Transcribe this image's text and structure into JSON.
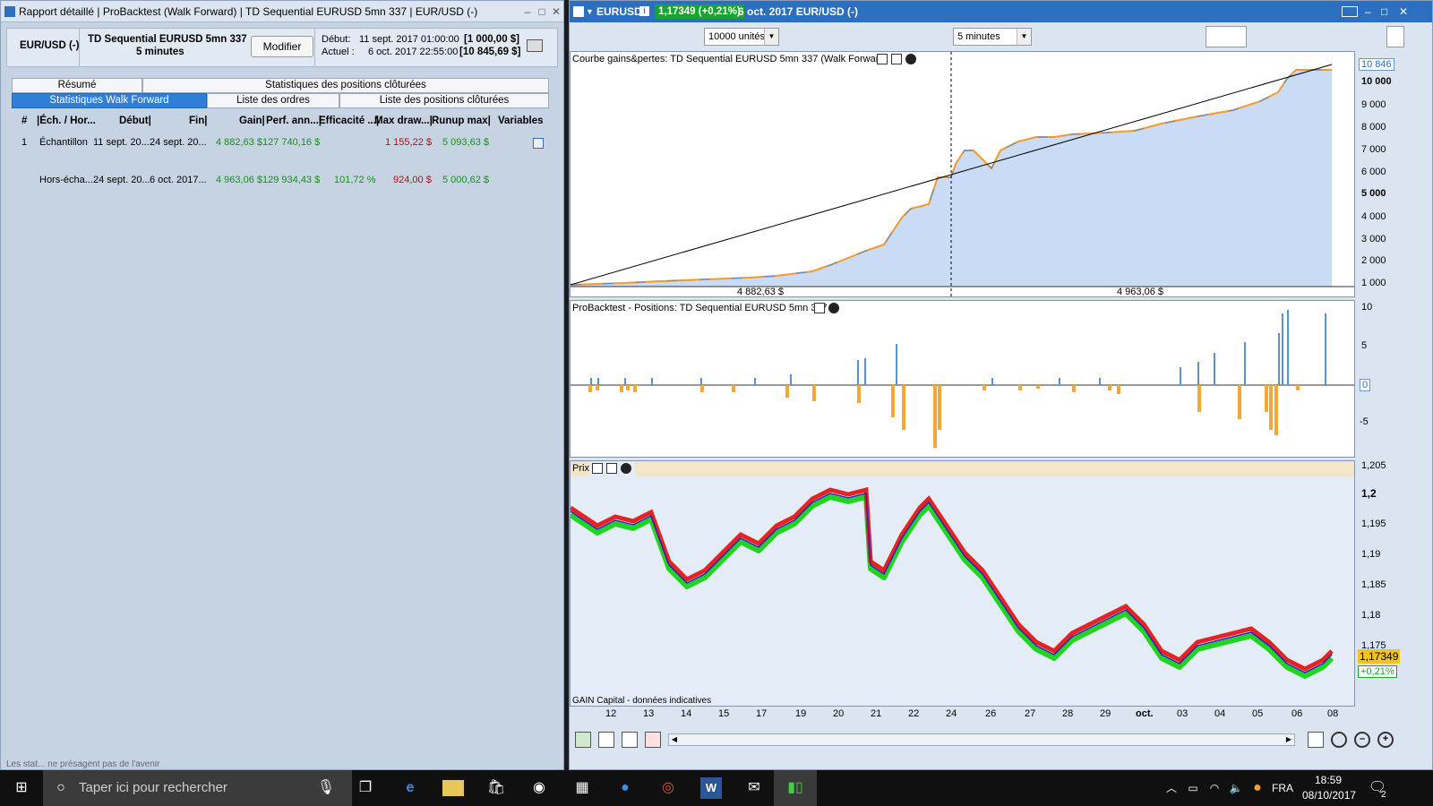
{
  "left": {
    "title": "Rapport détaillé | ProBacktest (Walk Forward) | TD Sequential EURUSD 5mn 337 | EUR/USD (-)",
    "instrument": "EUR/USD (-)",
    "system_name": "TD Sequential EURUSD 5mn 337",
    "timeframe": "5 minutes",
    "modify_label": "Modifier",
    "start_label": "Début:",
    "start_value": "11 sept. 2017 01:00:00",
    "start_capital": "[1 000,00 $]",
    "current_label": "Actuel :",
    "current_value": "6 oct. 2017 22:55:00",
    "current_capital": "[10 845,69 $]",
    "tabs_row1": [
      "Résumé",
      "Statistiques des positions clôturées"
    ],
    "tabs_row2": [
      "Statistiques Walk Forward",
      "Liste des ordres",
      "Liste des positions clôturées"
    ],
    "columns": [
      "#",
      "|Éch. / Hor...",
      "Début|",
      "Fin|",
      "Gain|",
      "Perf. ann...|",
      "Efficacité ...|",
      "Max draw...|",
      "Runup max|",
      "Variables"
    ],
    "rows": [
      {
        "num": "1",
        "sample": "Échantillon",
        "start": "11 sept. 20...",
        "end": "24 sept. 20...",
        "gain": "4 882,63 $",
        "perf": "127 740,16 $",
        "eff": "",
        "dd": "1 155,22 $",
        "runup": "5 093,63 $"
      },
      {
        "num": "",
        "sample": "Hors-écha...",
        "start": "24 sept. 20...",
        "end": "6 oct. 2017...",
        "gain": "4 963,06 $",
        "perf": "129 934,43 $",
        "eff": "101,72 %",
        "dd": "924,00 $",
        "runup": "5 000,62 $"
      }
    ],
    "footer": "Les stat... ne présagent pas de l'avenir"
  },
  "right": {
    "symbol": "EURUSD",
    "price": "1,17349 (+0,21%)",
    "date_label": "6 oct. 2017 EUR/USD (-)",
    "units": "10000 unités",
    "interval": "5 minutes",
    "equity_title": "Courbe gains&pertes: TD Sequential EURUSD 5mn 337 (Walk Forward)",
    "equity_in": "4 882,63 $",
    "equity_out": "4 963,06 $",
    "equity_last": "10 846",
    "equity_ticks": [
      "10 000",
      "9 000",
      "8 000",
      "7 000",
      "6 000",
      "5 000",
      "4 000",
      "3 000",
      "2 000",
      "1 000"
    ],
    "positions_title": "ProBacktest - Positions: TD Sequential EURUSD 5mn 337",
    "positions_ticks": [
      "10",
      "5",
      "0",
      "-5"
    ],
    "price_title": "Prix",
    "price_ticks": [
      "1,205",
      "1,2",
      "1,195",
      "1,19",
      "1,185",
      "1,18",
      "1,175"
    ],
    "price_last": "1,17349",
    "price_change": "+0,21%",
    "source": "GAIN Capital - données indicatives",
    "x_labels": [
      "12",
      "13",
      "14",
      "15",
      "17",
      "19",
      "20",
      "21",
      "22",
      "24",
      "26",
      "27",
      "28",
      "29",
      "oct.",
      "03",
      "04",
      "05",
      "06",
      "08"
    ]
  },
  "taskbar": {
    "search_placeholder": "Taper ici pour rechercher",
    "language": "FRA",
    "time": "18:59",
    "date": "08/10/2017",
    "notif_count": "2"
  }
}
